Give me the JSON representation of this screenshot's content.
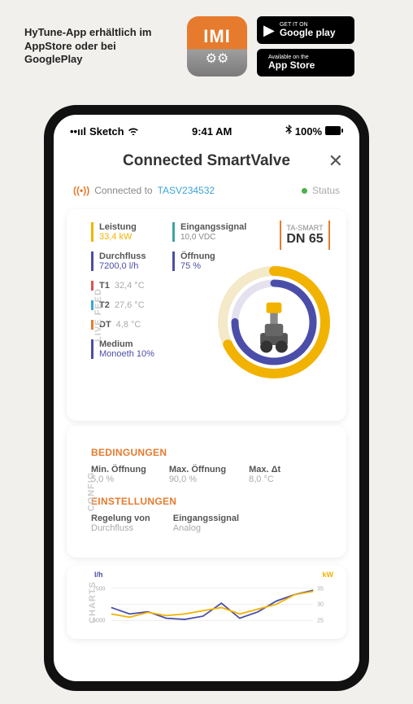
{
  "header": {
    "text": "HyTune-App erhältlich im AppStore oder bei GooglePlay",
    "app_icon_text": "IMI",
    "google": {
      "small": "GET IT ON",
      "big": "Google play"
    },
    "apple": {
      "small": "Available on the",
      "big": "App Store"
    }
  },
  "status_bar": {
    "carrier": "Sketch",
    "time": "9:41 AM",
    "battery": "100%"
  },
  "screen": {
    "title": "Connected SmartValve",
    "connected_label": "Connected to",
    "device_id": "TASV234532",
    "status_label": "Status"
  },
  "live": {
    "vlabel": "LIVE FEED",
    "leistung": {
      "label": "Leistung",
      "value": "33,4 kW"
    },
    "durchfluss": {
      "label": "Durchfluss",
      "value": "7200,0 l/h"
    },
    "signal": {
      "label": "Eingangssignal",
      "value": "10,0 VDC"
    },
    "offnung": {
      "label": "Öffnung",
      "value": "75 %"
    },
    "t1": {
      "label": "T1",
      "value": "32,4 °C"
    },
    "t2": {
      "label": "T2",
      "value": "27,6 °C"
    },
    "dt": {
      "label": "DT",
      "value": "4,8 °C"
    },
    "medium": {
      "label": "Medium",
      "value": "Monoeth 10%"
    },
    "product": {
      "series": "TA-SMART",
      "size": "DN 65"
    }
  },
  "config": {
    "vlabel": "CONFIG",
    "title1": "BEDINGUNGEN",
    "min_off": {
      "label": "Min. Öffnung",
      "value": "5,0 %"
    },
    "max_off": {
      "label": "Max. Öffnung",
      "value": "90,0 %"
    },
    "max_dt": {
      "label": "Max. Δt",
      "value": "8,0 °C"
    },
    "title2": "EINSTELLUNGEN",
    "regelung": {
      "label": "Regelung von",
      "value": "Durchfluss"
    },
    "signal": {
      "label": "Eingangssignal",
      "value": "Analog"
    }
  },
  "charts": {
    "vlabel": "CHARTS",
    "left_unit": "l/h",
    "right_unit": "kW",
    "left_ticks": [
      "7500",
      "6000"
    ],
    "right_ticks": [
      "35",
      "30",
      "25"
    ]
  },
  "chart_data": {
    "type": "line",
    "x": [
      0,
      1,
      2,
      3,
      4,
      5,
      6,
      7,
      8,
      9,
      10,
      11
    ],
    "series": [
      {
        "name": "l/h",
        "color": "#4b4ea8",
        "values": [
          6600,
          6300,
          6400,
          6100,
          6050,
          6200,
          6800,
          6100,
          6400,
          6900,
          7200,
          7400
        ],
        "axis": "left"
      },
      {
        "name": "kW",
        "color": "#f2b200",
        "values": [
          27,
          26,
          27.5,
          26.5,
          27,
          28,
          29,
          27,
          28.5,
          30,
          33,
          34
        ],
        "axis": "right"
      }
    ],
    "ylim_left": [
      6000,
      7500
    ],
    "ylim_right": [
      25,
      35
    ]
  }
}
